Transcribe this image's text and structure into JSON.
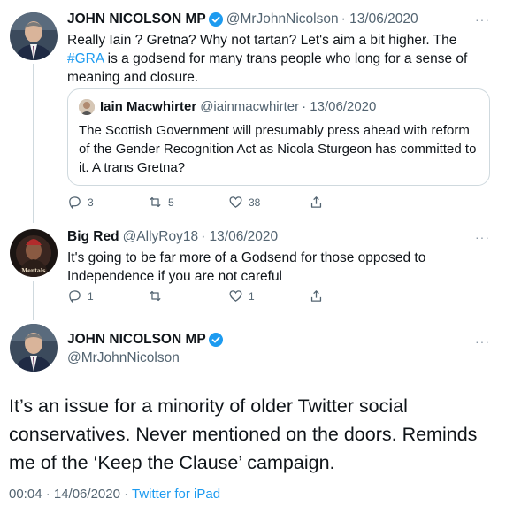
{
  "tweet1": {
    "name": "JOHN NICOLSON MP",
    "handle": "@MrJohnNicolson",
    "date": "· 13/06/2020",
    "more": "···",
    "text_before": "Really Iain ? Gretna? Why not tartan? Let's aim a bit higher. The ",
    "hashtag": "#GRA",
    "text_after": " is a godsend for many trans people who long for a sense of meaning and closure.",
    "quote": {
      "name": "Iain Macwhirter",
      "handle": "@iainmacwhirter",
      "date": "· 13/06/2020",
      "text": "The Scottish Government will presumably press ahead with reform of the Gender Recognition Act as Nicola Sturgeon has committed to it.  A trans Gretna?"
    },
    "replies": "3",
    "retweets": "5",
    "likes": "38"
  },
  "tweet2": {
    "name": "Big Red",
    "handle": "@AllyRoy18",
    "date": "· 13/06/2020",
    "more": "···",
    "text": "It's going to be far more of a Godsend for those opposed to Independence if you are not careful",
    "avatar_label": "Mentals",
    "replies": "1",
    "retweets": "",
    "likes": "1"
  },
  "main": {
    "name": "JOHN NICOLSON MP",
    "handle": "@MrJohnNicolson",
    "more": "···",
    "text": "It’s an issue for a minority of older Twitter social conservatives. Never mentioned on the doors. Reminds me of the ‘Keep the Clause’ campaign.",
    "timestamp": "00:04 · 14/06/2020 · ",
    "client": "Twitter for iPad"
  },
  "colors": {
    "accent": "#1d9bf0",
    "muted": "#536471",
    "border": "#cfd9de"
  }
}
